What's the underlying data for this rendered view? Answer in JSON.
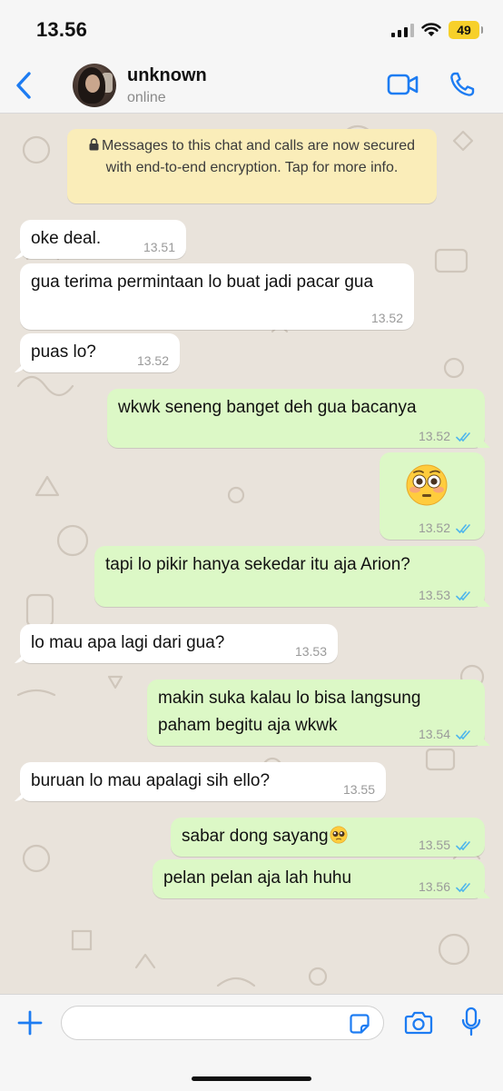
{
  "status_bar": {
    "time": "13.56",
    "battery": "49"
  },
  "header": {
    "contact_name": "unknown",
    "contact_status": "online",
    "back_icon": "chevron-left-icon",
    "video_icon": "video-camera-icon",
    "call_icon": "phone-icon"
  },
  "encryption_notice": {
    "text": "Messages to this chat and calls are now secured with end-to-end encryption. Tap for more info."
  },
  "messages": [
    {
      "direction": "in",
      "text": "oke deal.",
      "time": "13.51"
    },
    {
      "direction": "in",
      "text": "gua terima permintaan lo buat jadi pacar gua",
      "time": "13.52"
    },
    {
      "direction": "in",
      "text": "puas lo?",
      "time": "13.52"
    },
    {
      "direction": "out",
      "text": "wkwk seneng banget deh gua bacanya",
      "time": "13.52",
      "status": "read"
    },
    {
      "direction": "out",
      "emoji": "flushed-face-emoji",
      "time": "13.52",
      "status": "read"
    },
    {
      "direction": "out",
      "text": "tapi lo pikir hanya sekedar itu aja Arion?",
      "time": "13.53",
      "status": "read"
    },
    {
      "direction": "in",
      "text": "lo mau apa lagi dari gua?",
      "time": "13.53"
    },
    {
      "direction": "out",
      "text": "makin suka kalau lo bisa langsung paham begitu aja wkwk",
      "time": "13.54",
      "status": "read"
    },
    {
      "direction": "in",
      "text": "buruan lo mau apalagi sih ello?",
      "time": "13.55"
    },
    {
      "direction": "out",
      "text": "sabar dong sayang",
      "emoji": "pleading-face-emoji",
      "time": "13.55",
      "status": "read"
    },
    {
      "direction": "out",
      "text": "pelan pelan aja lah huhu",
      "time": "13.56",
      "status": "read"
    }
  ],
  "input_bar": {
    "placeholder": "",
    "attach_icon": "plus-icon",
    "sticker_icon": "sticker-icon",
    "camera_icon": "camera-icon",
    "mic_icon": "microphone-icon"
  },
  "colors": {
    "accent": "#1d7cf2",
    "incoming_bubble": "#ffffff",
    "outgoing_bubble": "#dcf8c6",
    "chat_background": "#e9e3db",
    "encryption_notice_bg": "#faedb9",
    "read_ticks": "#4fb6ec",
    "battery": "#f7d02a"
  }
}
